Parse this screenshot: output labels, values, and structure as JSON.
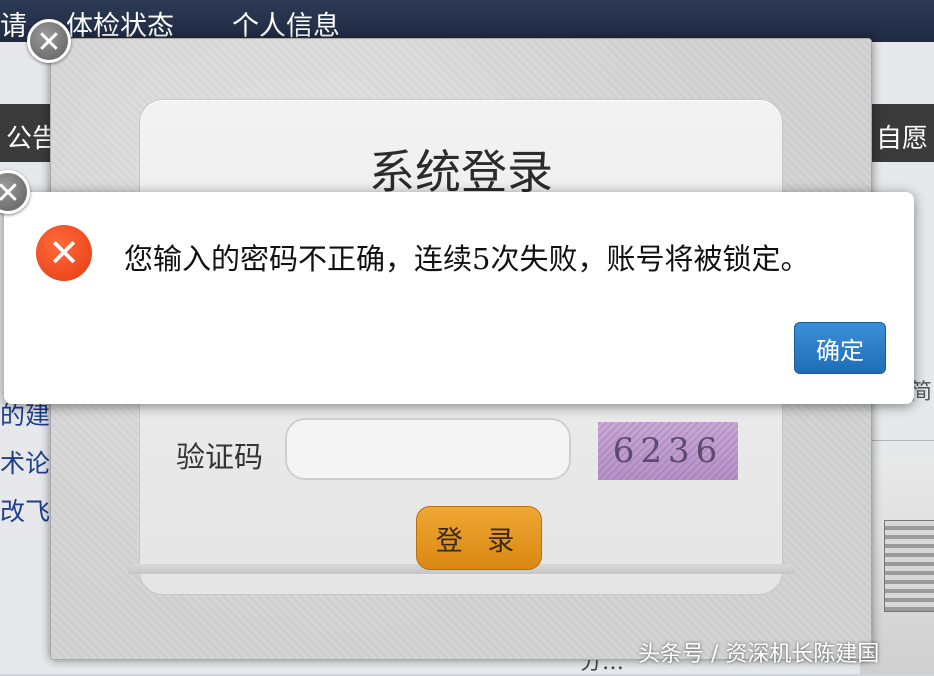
{
  "background": {
    "nav_items": [
      "请",
      "体检状态",
      "个人信息"
    ],
    "left_strip_text": "公告",
    "right_strip_text": "自愿",
    "left_links": [
      "的建",
      "术论",
      "改飞"
    ],
    "right_partial_text": "简",
    "bottom_text": "分…"
  },
  "login": {
    "title": "系统登录",
    "captcha_label": "验证码",
    "captcha_input_value": "",
    "captcha_code": "6236",
    "login_button": "登 录"
  },
  "alert": {
    "message": "您输入的密码不正确，连续5次失败，账号将被锁定。",
    "ok_button": "确定"
  },
  "watermark": "头条号 / 资深机长陈建国",
  "icons": {
    "close": "close-icon",
    "error": "error-icon"
  },
  "colors": {
    "accent_blue": "#2a7cc7",
    "login_orange": "#e49a22",
    "error_red": "#e8461f"
  }
}
